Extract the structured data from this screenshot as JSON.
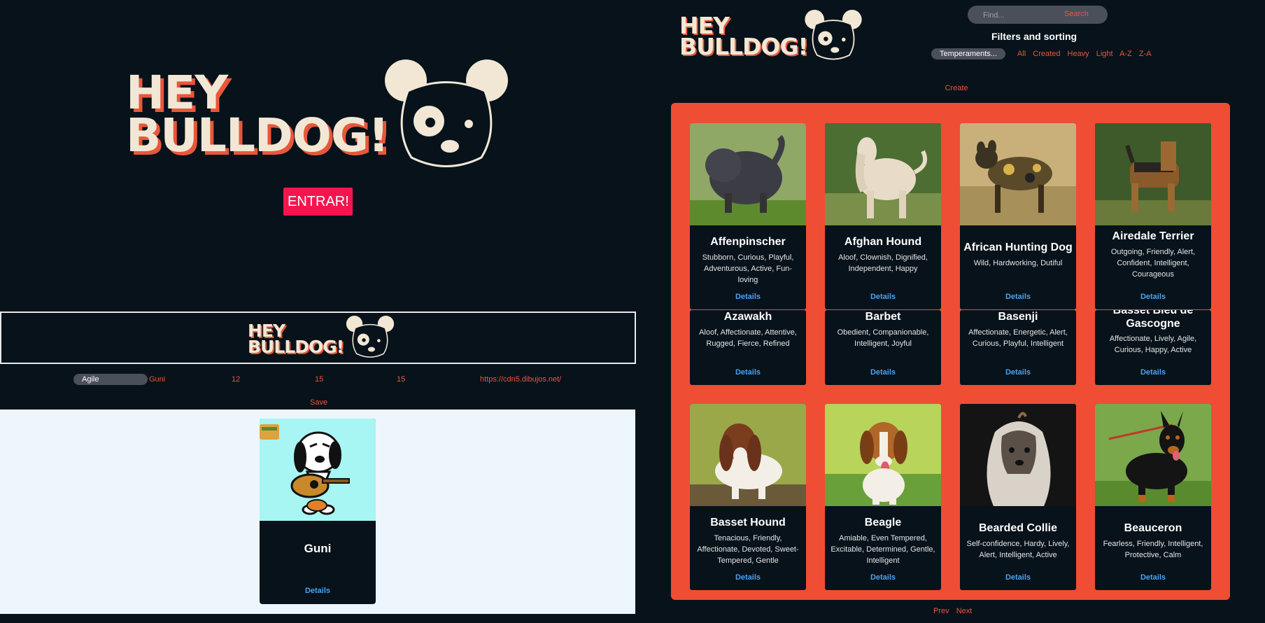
{
  "brand": {
    "line1": "HEY",
    "line2": "BULLDOG!"
  },
  "landing": {
    "enter_label": "ENTRAR!"
  },
  "create_form": {
    "temperament_value": "Agile",
    "name_value": "Guni",
    "height_value": "12",
    "weight_value": "15",
    "life_span_value": "15",
    "image_url_value": "https://cdn5.dibujos.net/",
    "save_label": "Save",
    "preview": {
      "name": "Guni",
      "details_label": "Details"
    }
  },
  "home": {
    "search": {
      "placeholder": "Find...",
      "button_label": "Search"
    },
    "filters_title": "Filters and sorting",
    "temperaments_select": "Temperaments...",
    "filter_links": [
      "All",
      "Created",
      "Heavy",
      "Light",
      "A-Z",
      "Z-A"
    ],
    "create_label": "Create",
    "pager": {
      "prev": "Prev",
      "next": "Next"
    },
    "cards": [
      {
        "name": "Affenpinscher",
        "temperament": "Stubborn, Curious, Playful, Adventurous, Active, Fun-loving",
        "details": "Details"
      },
      {
        "name": "Afghan Hound",
        "temperament": "Aloof, Clownish, Dignified, Independent, Happy",
        "details": "Details"
      },
      {
        "name": "African Hunting Dog",
        "temperament": "Wild, Hardworking, Dutiful",
        "details": "Details"
      },
      {
        "name": "Airedale Terrier",
        "temperament": "Outgoing, Friendly, Alert, Confident, Intelligent, Courageous",
        "details": "Details"
      },
      {
        "name": "Azawakh",
        "temperament": "Aloof, Affectionate, Attentive, Rugged, Fierce, Refined",
        "details": "Details"
      },
      {
        "name": "Barbet",
        "temperament": "Obedient, Companionable, Intelligent, Joyful",
        "details": "Details"
      },
      {
        "name": "Basenji",
        "temperament": "Affectionate, Energetic, Alert, Curious, Playful, Intelligent",
        "details": "Details"
      },
      {
        "name": "Basset Bleu de Gascogne",
        "temperament": "Affectionate, Lively, Agile, Curious, Happy, Active",
        "details": "Details"
      },
      {
        "name": "Basset Hound",
        "temperament": "Tenacious, Friendly, Affectionate, Devoted, Sweet-Tempered, Gentle",
        "details": "Details"
      },
      {
        "name": "Beagle",
        "temperament": "Amiable, Even Tempered, Excitable, Determined, Gentle, Intelligent",
        "details": "Details"
      },
      {
        "name": "Bearded Collie",
        "temperament": "Self-confidence, Hardy, Lively, Alert, Intelligent, Active",
        "details": "Details"
      },
      {
        "name": "Beauceron",
        "temperament": "Fearless, Friendly, Intelligent, Protective, Calm",
        "details": "Details"
      }
    ]
  },
  "colors": {
    "accent": "#e8573a",
    "background": "#07121a",
    "panel": "#f04d35",
    "enter": "#f5154e",
    "link": "#4aa3f0"
  }
}
